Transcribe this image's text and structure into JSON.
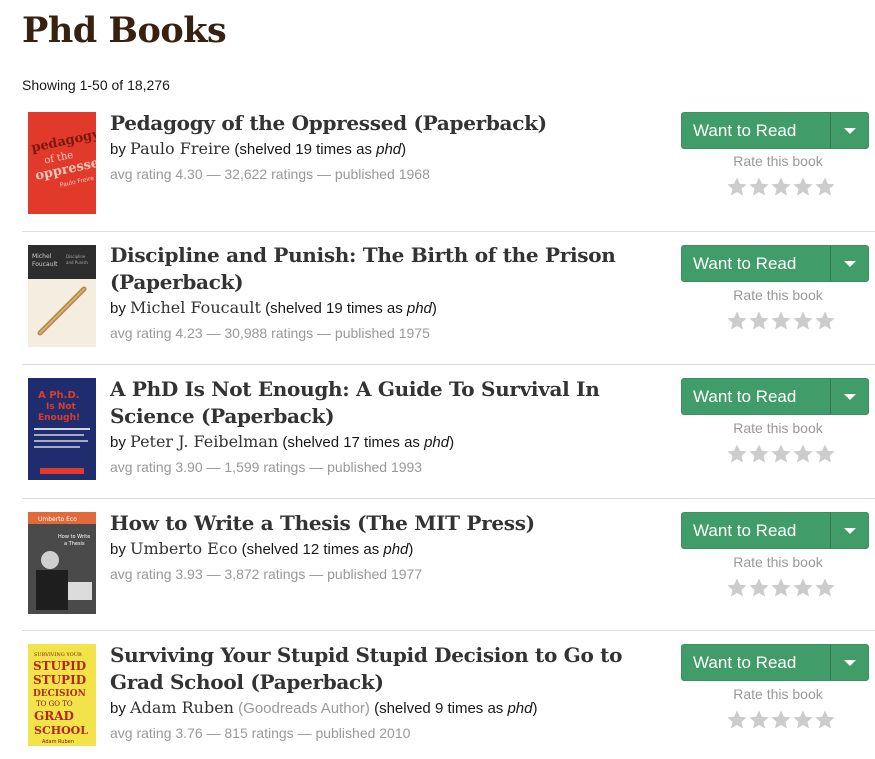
{
  "page": {
    "title": "Phd Books",
    "results_count": "Showing 1-50 of 18,276"
  },
  "common": {
    "want_to_read": "Want to Read",
    "rate_label": "Rate this book",
    "by": "by",
    "star_color": "#cccccc",
    "button_color": "#409d69"
  },
  "books": [
    {
      "title": "Pedagogy of the Oppressed (Paperback)",
      "author": "Paulo Freire",
      "author_role": "",
      "shelved": "(shelved 19 times as ",
      "shelf": "phd",
      "shelved_end": ")",
      "meta": "avg rating 4.30 — 32,622 ratings — published 1968",
      "cover": {
        "bg": "#e23a2a",
        "text": "pedagogy of the oppressed",
        "subtext": "Paulo Freire"
      }
    },
    {
      "title": "Discipline and Punish: The Birth of the Prison (Paperback)",
      "author": "Michel Foucault",
      "author_role": "",
      "shelved": "(shelved 19 times as ",
      "shelf": "phd",
      "shelved_end": ")",
      "meta": "avg rating 4.23 — 30,988 ratings — published 1975",
      "cover": {
        "bg": "#f2ede0",
        "text": "Michel Foucault",
        "subtext": "Discipline and Punish"
      }
    },
    {
      "title": "A PhD Is Not Enough: A Guide To Survival In Science (Paperback)",
      "author": "Peter J. Feibelman",
      "author_role": "",
      "shelved": "(shelved 17 times as ",
      "shelf": "phd",
      "shelved_end": ")",
      "meta": "avg rating 3.90 — 1,599 ratings — published 1993",
      "cover": {
        "bg": "#1f2d6e",
        "text": "A Ph.D. Is Not Enough!",
        "subtext": "Peter J. Feibelman"
      }
    },
    {
      "title": "How to Write a Thesis (The MIT Press)",
      "author": "Umberto Eco",
      "author_role": "",
      "shelved": "(shelved 12 times as ",
      "shelf": "phd",
      "shelved_end": ")",
      "meta": "avg rating 3.93 — 3,872 ratings — published 1977",
      "cover": {
        "bg": "#3a3a3a",
        "text": "Umberto Eco",
        "subtext": "How to Write a Thesis"
      }
    },
    {
      "title": "Surviving Your Stupid Stupid Decision to Go to Grad School (Paperback)",
      "author": "Adam Ruben",
      "author_role": "(Goodreads Author)",
      "shelved": " (shelved 9 times as ",
      "shelf": "phd",
      "shelved_end": ")",
      "meta": "avg rating 3.76 — 815 ratings — published 2010",
      "cover": {
        "bg": "#f3e34a",
        "text": "SURVIVING YOUR STUPID STUPID DECISION TO GO TO GRAD SCHOOL",
        "subtext": "Adam Ruben"
      }
    }
  ]
}
